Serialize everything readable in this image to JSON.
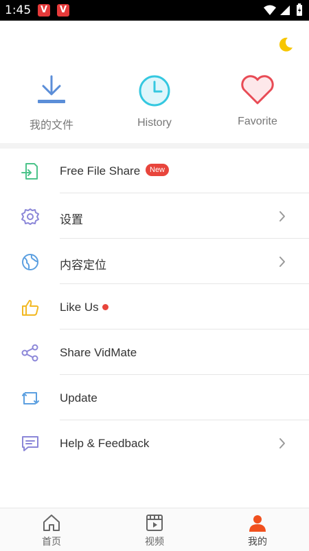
{
  "status_bar": {
    "time": "1:45",
    "notif_badges": [
      "V",
      "V"
    ]
  },
  "header": {
    "night_mode_icon": "moon-icon"
  },
  "quick_actions": [
    {
      "label": "我的文件",
      "icon": "download-icon"
    },
    {
      "label": "History",
      "icon": "clock-icon"
    },
    {
      "label": "Favorite",
      "icon": "heart-icon"
    }
  ],
  "menu": [
    {
      "label": "Free File Share",
      "icon": "file-share-icon",
      "badge": "New"
    },
    {
      "label": "设置",
      "icon": "gear-icon"
    },
    {
      "label": "内容定位",
      "icon": "globe-icon"
    },
    {
      "label": "Like Us",
      "icon": "thumbs-up-icon"
    },
    {
      "label": "Share VidMate",
      "icon": "share-icon"
    },
    {
      "label": "Update",
      "icon": "update-icon"
    },
    {
      "label": "Help & Feedback",
      "icon": "feedback-icon"
    }
  ],
  "bottom_nav": [
    {
      "label": "首页",
      "icon": "home-icon"
    },
    {
      "label": "视频",
      "icon": "video-icon"
    },
    {
      "label": "我的",
      "icon": "profile-icon",
      "active": true
    }
  ],
  "colors": {
    "accent_red": "#e8453c",
    "icon_blue": "#5b8ed8",
    "history_teal": "#35c8e0",
    "favorite_red": "#e84b55",
    "moon_yellow": "#f7c600",
    "profile_orange": "#f0501e"
  }
}
